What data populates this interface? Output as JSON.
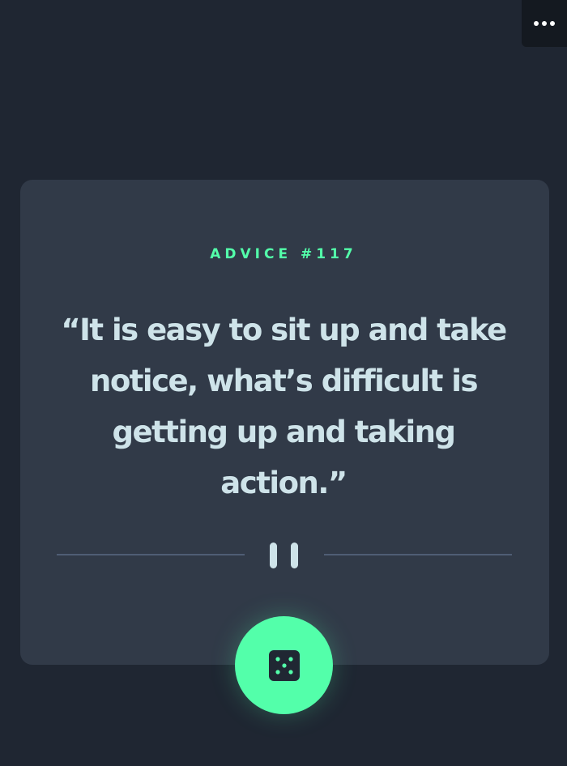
{
  "menu": {
    "icon": "more-horizontal-icon"
  },
  "advice": {
    "label": "ADVICE #117",
    "quote": "“It is easy to sit up and take notice, what’s difficult is getting up and taking action.”"
  },
  "divider": {
    "icon": "pause-icon"
  },
  "generate_button": {
    "icon": "dice-icon"
  },
  "colors": {
    "background": "#1f2632",
    "card": "#313a48",
    "accent": "#53ffaa",
    "text": "#cee3e9",
    "divider": "#4f5d74"
  }
}
